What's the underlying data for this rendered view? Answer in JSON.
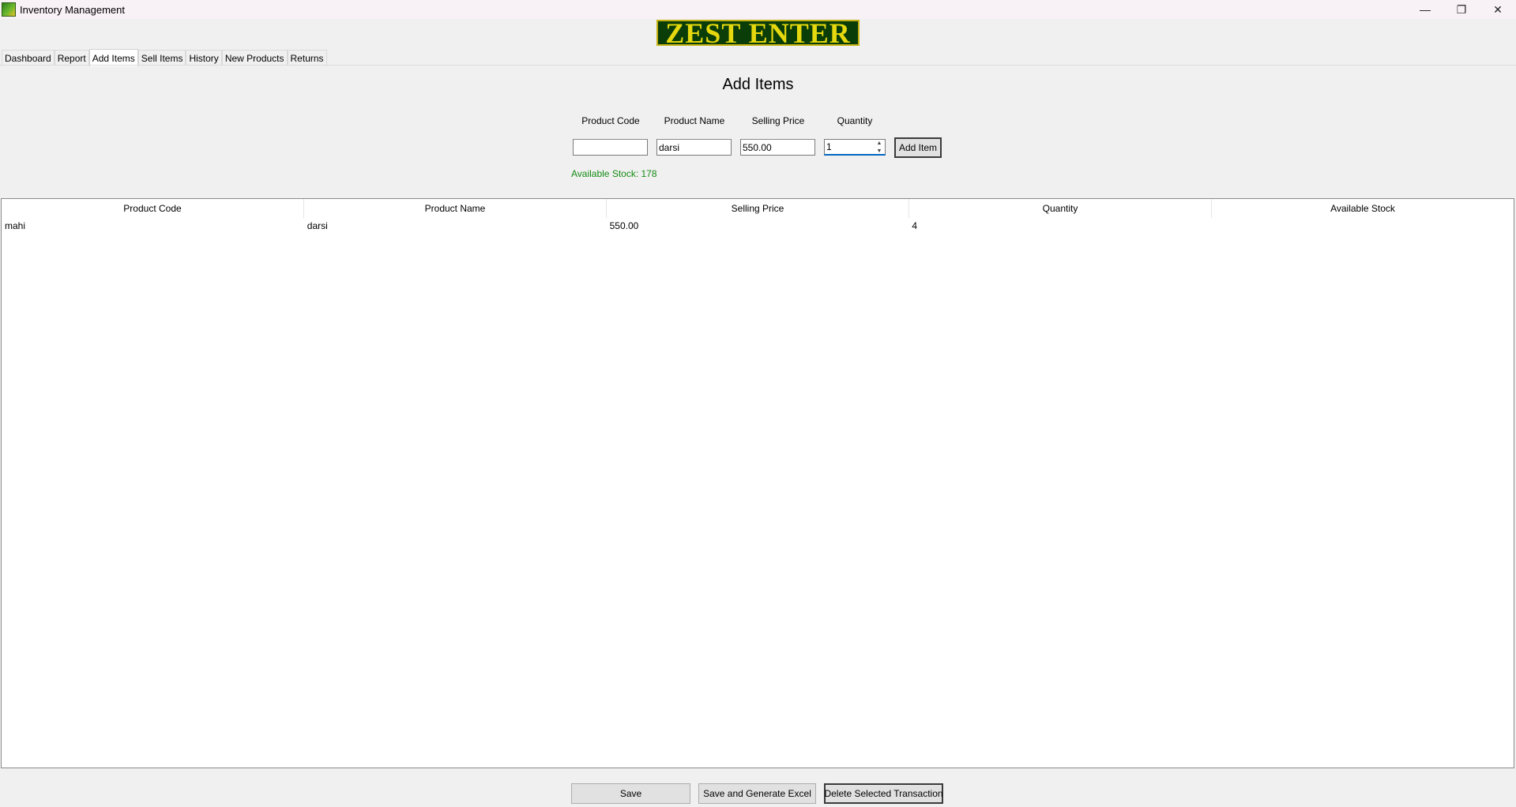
{
  "window": {
    "title": "Inventory Management",
    "controls": {
      "minimize": "—",
      "restore": "❐",
      "close": "✕"
    }
  },
  "logo": {
    "text": "ZEST ENTER"
  },
  "tabs": [
    {
      "label": "Dashboard",
      "active": false
    },
    {
      "label": "Report",
      "active": false
    },
    {
      "label": "Add Items",
      "active": true
    },
    {
      "label": "Sell Items",
      "active": false
    },
    {
      "label": "History",
      "active": false
    },
    {
      "label": "New Products",
      "active": false
    },
    {
      "label": "Returns",
      "active": false
    }
  ],
  "form": {
    "heading": "Add Items",
    "labels": {
      "product_code": "Product Code",
      "product_name": "Product Name",
      "selling_price": "Selling Price",
      "quantity": "Quantity"
    },
    "values": {
      "product_code": "",
      "product_name": "darsi",
      "selling_price": "550.00",
      "quantity": "1"
    },
    "add_button": "Add Item",
    "available_stock": "Available Stock: 178"
  },
  "table": {
    "columns": [
      "Product Code",
      "Product Name",
      "Selling Price",
      "Quantity",
      "Available Stock"
    ],
    "rows": [
      [
        "mahi",
        "darsi",
        "550.00",
        "4",
        ""
      ]
    ]
  },
  "actions": {
    "save": "Save",
    "save_excel": "Save and Generate Excel",
    "delete": "Delete Selected Transaction"
  },
  "colors": {
    "stock_text": "#158b15",
    "focus": "#0067c0",
    "logo_bg": "#0a3d07",
    "logo_text": "#e6d80e"
  }
}
